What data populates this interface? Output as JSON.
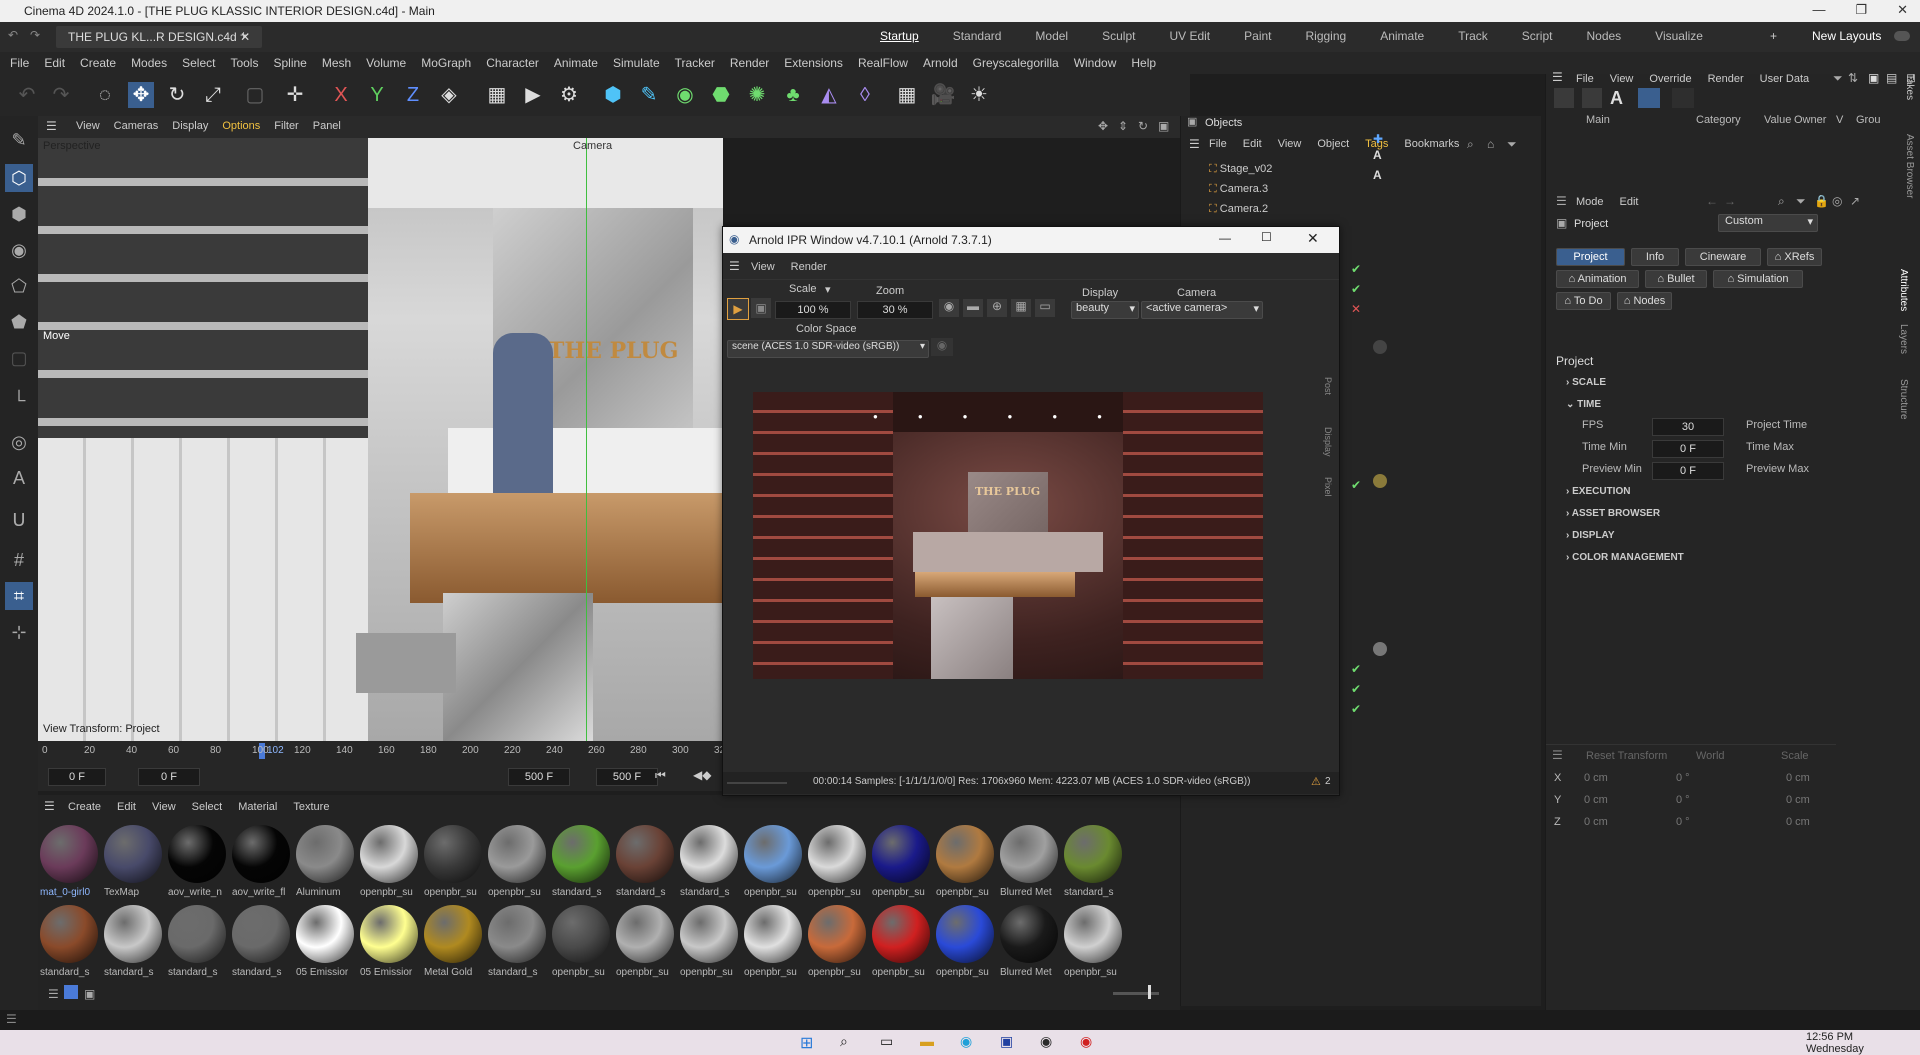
{
  "window": {
    "title": "Cinema 4D 2024.1.0 - [THE PLUG KLASSIC INTERIOR DESIGN.c4d] - Main"
  },
  "tabs": {
    "file_tab": "THE PLUG KL...R DESIGN.c4d",
    "layouts": [
      "Startup",
      "Standard",
      "Model",
      "Sculpt",
      "UV Edit",
      "Paint",
      "Rigging",
      "Animate",
      "Track",
      "Script",
      "Nodes",
      "Visualize"
    ],
    "new_layouts": "New Layouts"
  },
  "menu": [
    "File",
    "Edit",
    "Create",
    "Modes",
    "Select",
    "Tools",
    "Spline",
    "Mesh",
    "Volume",
    "MoGraph",
    "Character",
    "Animate",
    "Simulate",
    "Tracker",
    "Render",
    "Extensions",
    "RealFlow",
    "Arnold",
    "Greyscalegorilla",
    "Window",
    "Help"
  ],
  "viewport": {
    "menu": [
      "View",
      "Cameras",
      "Display",
      "Options",
      "Filter",
      "Panel"
    ],
    "label": "Perspective",
    "camera_label": "Camera",
    "move_label": "Move",
    "view_transform": "View Transform: Project",
    "signage": "THE PLUG"
  },
  "timeline": {
    "ticks": [
      "0",
      "20",
      "40",
      "60",
      "80",
      "100",
      "120",
      "140",
      "160",
      "180",
      "200",
      "220",
      "240",
      "260",
      "280",
      "300",
      "32"
    ],
    "current": "102"
  },
  "transport": {
    "start": "0 F",
    "current": "0 F",
    "end1": "500 F",
    "end2": "500 F"
  },
  "materials": {
    "menu": [
      "Create",
      "Edit",
      "View",
      "Select",
      "Material",
      "Texture"
    ],
    "row1": [
      {
        "label": "mat_0-girl0",
        "color": "#6b3b5a"
      },
      {
        "label": "TexMap",
        "color": "#484a6a"
      },
      {
        "label": "aov_write_n",
        "color": "#050505"
      },
      {
        "label": "aov_write_fl",
        "color": "#050505"
      },
      {
        "label": "Aluminum",
        "color": "#8a8a8a"
      },
      {
        "label": "openpbr_su",
        "color": "#d8d8d8"
      },
      {
        "label": "openpbr_su",
        "color": "#3a3a3a"
      },
      {
        "label": "openpbr_su",
        "color": "#9a9a9a"
      },
      {
        "label": "standard_s",
        "color": "#5aa030"
      },
      {
        "label": "standard_s",
        "color": "#6a4236"
      },
      {
        "label": "standard_s",
        "color": "#dcdcdc"
      },
      {
        "label": "openpbr_su",
        "color": "#6a9ad8"
      },
      {
        "label": "openpbr_su",
        "color": "#dadada"
      },
      {
        "label": "openpbr_su",
        "color": "#1a1a8a"
      },
      {
        "label": "openpbr_su",
        "color": "#b07a40"
      },
      {
        "label": "Blurred Met",
        "color": "#a0a0a0"
      },
      {
        "label": "standard_s",
        "color": "#6a8a30"
      }
    ],
    "row2": [
      {
        "label": "standard_s",
        "color": "#8a4a2a"
      },
      {
        "label": "standard_s",
        "color": "#c8c8c8"
      },
      {
        "label": "standard_s",
        "color": "#6a6a6a"
      },
      {
        "label": "standard_s",
        "color": "#6a6a6a"
      },
      {
        "label": "05 Emissior",
        "color": "#ffffff"
      },
      {
        "label": "05 Emissior",
        "color": "#ffff90"
      },
      {
        "label": "Metal Gold",
        "color": "#b08a20"
      },
      {
        "label": "standard_s",
        "color": "#8a8a8a"
      },
      {
        "label": "openpbr_su",
        "color": "#4a4a4a"
      },
      {
        "label": "openpbr_su",
        "color": "#b0b0b0"
      },
      {
        "label": "openpbr_su",
        "color": "#c8c8c8"
      },
      {
        "label": "openpbr_su",
        "color": "#e0e0e0"
      },
      {
        "label": "openpbr_su",
        "color": "#c86a3a"
      },
      {
        "label": "openpbr_su",
        "color": "#d02020"
      },
      {
        "label": "openpbr_su",
        "color": "#2a4ad8"
      },
      {
        "label": "Blurred Met",
        "color": "#1a1a1a"
      },
      {
        "label": "openpbr_su",
        "color": "#d0d0d0"
      }
    ]
  },
  "objects": {
    "title": "Objects",
    "menu": [
      "File",
      "Edit",
      "View",
      "Object",
      "Tags",
      "Bookmarks"
    ],
    "rows": [
      "Stage_v02",
      "Camera.3",
      "Camera.2"
    ]
  },
  "ipr": {
    "title": "Arnold IPR Window v4.7.10.1 (Arnold 7.3.7.1)",
    "menu": [
      "View",
      "Render"
    ],
    "scale_label": "Scale",
    "scale_value": "100 %",
    "zoom_label": "Zoom",
    "zoom_value": "30 %",
    "display_label": "Display",
    "display_value": "beauty",
    "camera_label": "Camera",
    "camera_value": "<active camera>",
    "colorspace_label": "Color Space",
    "colorspace_value": "scene (ACES 1.0 SDR-video (sRGB))",
    "side_tabs": [
      "Post",
      "Display",
      "Pixel"
    ],
    "status": "00:00:14  Samples: [-1/1/1/1/0/0]  Res: 1706x960  Mem: 4223.07 MB  (ACES 1.0 SDR-video (sRGB))",
    "warnings": "2",
    "render_sign": "THE PLUG"
  },
  "attributes": {
    "top_menu": [
      "File",
      "View",
      "Override",
      "Render",
      "User Data"
    ],
    "layer_header": [
      "Main",
      "Category",
      "Value",
      "Owner",
      "V",
      "Grou"
    ],
    "mode_menu": [
      "Mode",
      "Edit"
    ],
    "project_label": "Project",
    "project_preset": "Custom",
    "tabs_row1": [
      "Project",
      "Info",
      "Cineware",
      "XRefs"
    ],
    "tabs_row2": [
      "Animation",
      "Bullet",
      "Simulation"
    ],
    "tabs_row3": [
      "To Do",
      "Nodes"
    ],
    "heading": "Project",
    "sections": [
      "SCALE",
      "TIME",
      "EXECUTION",
      "ASSET BROWSER",
      "DISPLAY",
      "COLOR MANAGEMENT"
    ],
    "fps_label": "FPS",
    "fps_value": "30",
    "project_time_label": "Project Time",
    "time_min_label": "Time Min",
    "time_min_value": "0 F",
    "time_max_label": "Time Max",
    "preview_min_label": "Preview Min",
    "preview_min_value": "0 F",
    "preview_max_label": "Preview Max",
    "side_tabs": [
      "Attributes",
      "Layers",
      "Structure"
    ],
    "takes_tab": "Takes",
    "asset_browser_tab": "Asset Browser"
  },
  "coords": {
    "header": [
      "Reset Transform",
      "World",
      "Scale"
    ],
    "axes": [
      "X",
      "Y",
      "Z"
    ],
    "pos": [
      "0 cm",
      "0 cm",
      "0 cm"
    ],
    "rot": [
      "0 °",
      "0 °",
      "0 °"
    ],
    "scale": [
      "0 cm",
      "0 cm",
      "0 cm"
    ]
  },
  "taskbar": {
    "time": "12:56 PM",
    "day": "Wednesday"
  }
}
